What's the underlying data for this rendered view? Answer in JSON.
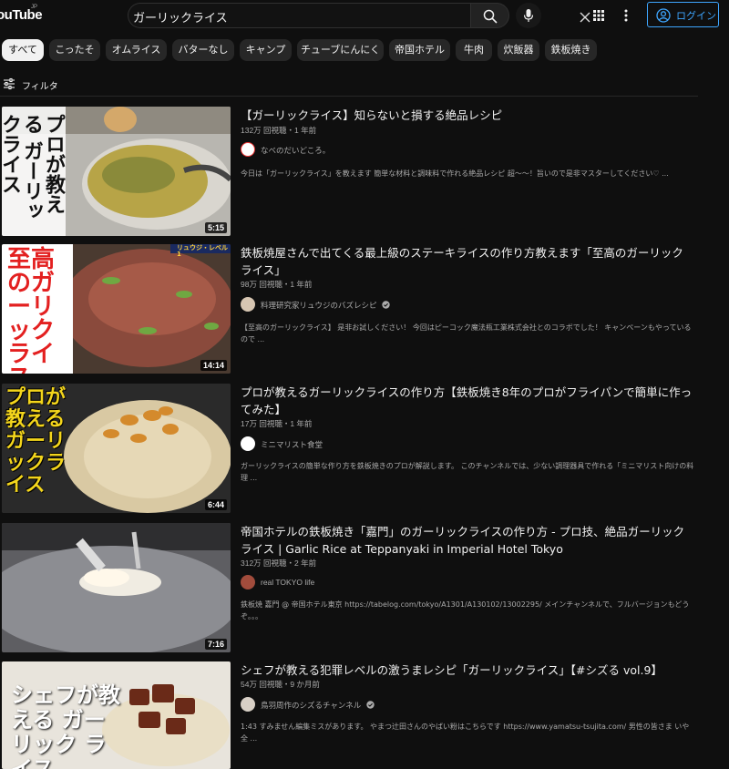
{
  "header": {
    "logo_text": "ouTube",
    "logo_region": "JP",
    "search_query": "ガーリックライス",
    "login_label": "ログイン"
  },
  "chips": [
    {
      "label": "すべて",
      "active": true
    },
    {
      "label": "こったそ"
    },
    {
      "label": "オムライス"
    },
    {
      "label": "バターなし"
    },
    {
      "label": "キャンプ"
    },
    {
      "label": "チューブにんにく"
    },
    {
      "label": "帝国ホテル"
    },
    {
      "label": "牛肉"
    },
    {
      "label": "炊飯器"
    },
    {
      "label": "鉄板焼き"
    }
  ],
  "filter_label": "フィルタ",
  "results": [
    {
      "title": "【ガーリックライス】知らないと損する絶品レシピ",
      "meta": "132万 回視聴・1 年前",
      "channel": "なべのだいどころ。",
      "verified": false,
      "description": "今日は「ガーリックライス」を教えます 簡単な材料と調味料で作れる絶品レシピ 超〜〜！旨いので是非マスターしてください♡ ...",
      "duration": "5:15",
      "thumb_caption": "プロが教える ガーリックライス"
    },
    {
      "title": "鉄板焼屋さんで出てくる最上級のステーキライスの作り方教えます「至高のガーリックライス」",
      "meta": "98万 回視聴・1 年前",
      "channel": "料理研究家リュウジのバズレシピ",
      "verified": true,
      "description": "【至高のガーリックライス】 是非お試しください！ 今回はピーコック魔法瓶工業株式会社とのコラボでした！ キャンペーンもやっているので ...",
      "duration": "14:14",
      "thumb_caption": "至高のガーリックライス",
      "thumb_badge": "リュウジ・レベル1"
    },
    {
      "title": "プロが教えるガーリックライスの作り方【鉄板焼き8年のプロがフライパンで簡単に作ってみた】",
      "meta": "17万 回視聴・1 年前",
      "channel": "ミニマリスト食堂",
      "verified": false,
      "description": "ガーリックライスの簡単な作り方を鉄板焼きのプロが解説します。 このチャンネルでは、少ない調理器具で作れる「ミニマリスト向けの料理 ...",
      "duration": "6:44",
      "thumb_caption": "プロが教える ガーリックライス"
    },
    {
      "title": "帝国ホテルの鉄板焼き「嘉門」のガーリックライスの作り方 - プロ技、絶品ガーリックライス | Garlic Rice at Teppanyaki in Imperial Hotel Tokyo",
      "meta": "312万 回視聴・2 年前",
      "channel": "real TOKYO life",
      "verified": false,
      "description": "鉄板焼 嘉門 @ 帝国ホテル東京 https://tabelog.com/tokyo/A1301/A130102/13002295/ メインチャンネルで、フルバージョンもどうぞ。。。",
      "duration": "7:16"
    },
    {
      "title": "シェフが教える犯罪レベルの激うまレシピ「ガーリックライス」【#シズる vol.9】",
      "meta": "54万 回視聴・9 か月前",
      "channel": "鳥羽周作のシズるチャンネル",
      "verified": true,
      "description": "1:43 すみません編集ミスがあります。 やまつ辻田さんのやばい粉はこちらです https://www.yamatsu-tsujita.com/ 男性の皆さま いや全 ...",
      "thumb_caption": "シェフが教える ガーリック ライス"
    }
  ],
  "colors": {
    "background": "#0f0f0f",
    "chip_bg": "#272727",
    "accent_blue": "#3ea6ff",
    "text_primary": "#f1f1f1",
    "text_secondary": "#aaaaaa"
  }
}
